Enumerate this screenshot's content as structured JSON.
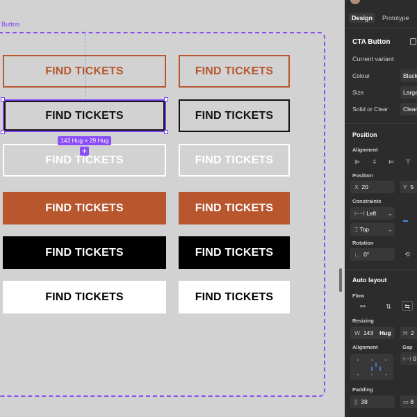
{
  "canvas": {
    "frame_label": "Button",
    "button_text": "FIND TICKETS",
    "size_badge": "143 Hug × 29 Hug",
    "add_symbol": "+",
    "rows": [
      {
        "variant": "outline-orange"
      },
      {
        "variant": "outline-black",
        "selected_left": true
      },
      {
        "variant": "outline-white"
      },
      {
        "variant": "fill-orange"
      },
      {
        "variant": "fill-black"
      },
      {
        "variant": "fill-white"
      }
    ],
    "colors": {
      "orange": "#b8562d",
      "black": "#000000",
      "white": "#ffffff",
      "selection": "#8b4df7"
    }
  },
  "panel": {
    "tabs": {
      "design": "Design",
      "prototype": "Prototype"
    },
    "component_title": "CTA Button",
    "current_variant": {
      "title": "Current variant",
      "props": [
        {
          "label": "Colour",
          "value": "Black"
        },
        {
          "label": "Size",
          "value": "Large"
        },
        {
          "label": "Solid or Clear",
          "value": "Clear"
        }
      ]
    },
    "position": {
      "title": "Position",
      "alignment_label": "Alignment",
      "position_label": "Position",
      "x_label": "X",
      "x_value": "20",
      "y_label": "Y",
      "y_value": "5",
      "constraints_label": "Constraints",
      "constraint_h": "Left",
      "constraint_v": "Top",
      "rotation_label": "Rotation",
      "rotation_value": "0°"
    },
    "auto_layout": {
      "title": "Auto layout",
      "flow_label": "Flow",
      "resizing_label": "Resizing",
      "w_label": "W",
      "w_value": "143",
      "w_mode": "Hug",
      "h_label": "H",
      "h_value": "2",
      "alignment_label": "Alignment",
      "gap_label": "Gap",
      "gap_value": "0",
      "padding_label": "Padding",
      "padding_value": "38",
      "padding_v_value": "8"
    }
  }
}
